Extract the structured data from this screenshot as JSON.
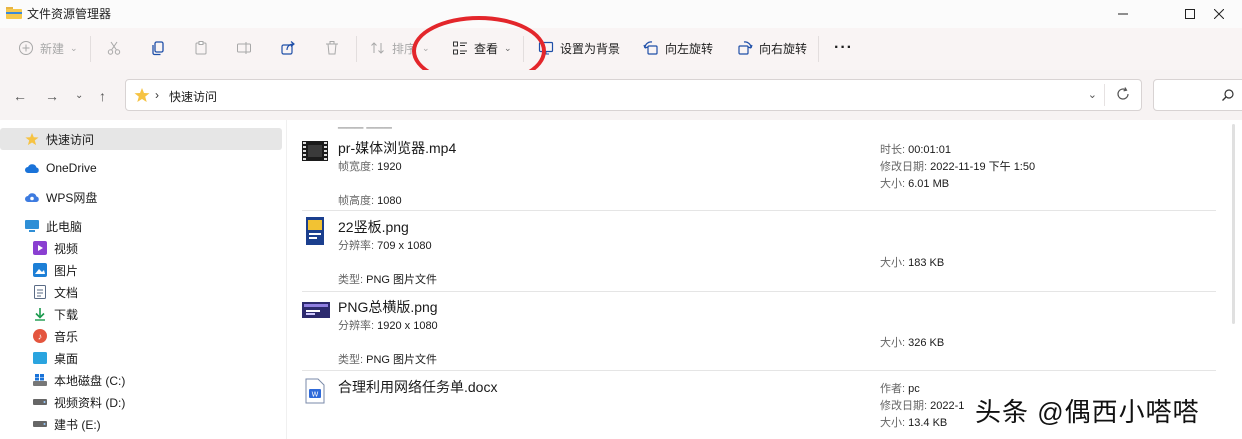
{
  "window": {
    "title": "文件资源管理器"
  },
  "toolbar": {
    "new_label": "新建",
    "sort_label": "排序",
    "view_label": "查看",
    "set_bg_label": "设置为背景",
    "rotate_left_label": "向左旋转",
    "rotate_right_label": "向右旋转",
    "more_label": "···"
  },
  "address": {
    "crumb": "快速访问"
  },
  "sidebar": {
    "items": [
      {
        "label": "快速访问"
      },
      {
        "label": "OneDrive"
      },
      {
        "label": "WPS网盘"
      },
      {
        "label": "此电脑"
      },
      {
        "label": "视频"
      },
      {
        "label": "图片"
      },
      {
        "label": "文档"
      },
      {
        "label": "下载"
      },
      {
        "label": "音乐"
      },
      {
        "label": "桌面"
      },
      {
        "label": "本地磁盘 (C:)"
      },
      {
        "label": "视频资料 (D:)"
      },
      {
        "label": "建书 (E:)"
      }
    ]
  },
  "files": [
    {
      "name": "pr-媒体浏览器.mp4",
      "left_meta": [
        {
          "label": "帧宽度:",
          "value": "1920"
        },
        {
          "label": "帧高度:",
          "value": "1080"
        }
      ],
      "right_meta": [
        {
          "label": "时长:",
          "value": "00:01:01"
        },
        {
          "label": "修改日期:",
          "value": "2022-11-19 下午 1:50"
        },
        {
          "label": "大小:",
          "value": "6.01 MB"
        }
      ]
    },
    {
      "name": "22竖板.png",
      "left_meta": [
        {
          "label": "分辨率:",
          "value": "709 x 1080"
        },
        {
          "label": "类型:",
          "value": "PNG 图片文件"
        }
      ],
      "right_meta": [
        {
          "label": "大小:",
          "value": "183 KB"
        }
      ]
    },
    {
      "name": "PNG总横版.png",
      "left_meta": [
        {
          "label": "分辨率:",
          "value": "1920 x 1080"
        },
        {
          "label": "类型:",
          "value": "PNG 图片文件"
        }
      ],
      "right_meta": [
        {
          "label": "大小:",
          "value": "326 KB"
        }
      ]
    },
    {
      "name": "合理利用网络任务单.docx",
      "left_meta": [],
      "right_meta": [
        {
          "label": "作者:",
          "value": "pc"
        },
        {
          "label": "修改日期:",
          "value": "2022-1"
        },
        {
          "label": "大小:",
          "value": "13.4 KB"
        }
      ]
    }
  ],
  "watermark": {
    "text": "头条 @偶西小嗒嗒"
  },
  "colors": {
    "annotation_circle": "#e3262b",
    "accent": "#0067c0"
  }
}
